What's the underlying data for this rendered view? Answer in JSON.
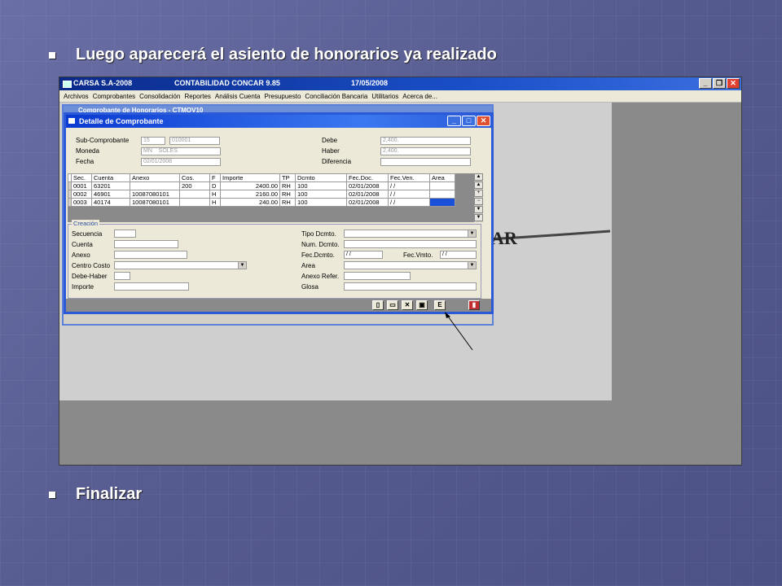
{
  "slide": {
    "bullet1": "Luego aparecerá el asiento de honorarios ya realizado",
    "bullet2": "Finalizar"
  },
  "app": {
    "title_company": "CARSA S.A-2008",
    "title_app": "CONTABILIDAD CONCAR 9.85",
    "title_date": "17/05/2008",
    "menu": [
      "Archivos",
      "Comprobantes",
      "Consolidación",
      "Reportes",
      "Análisis Cuenta",
      "Presupuesto",
      "Conciliación Bancaria",
      "Utilitarios",
      "Acerca de..."
    ],
    "logo_text": "AR"
  },
  "back_window": {
    "title": "Comprobante de Honorarios - CTMOV10"
  },
  "dialog": {
    "title": "Detalle de Comprobante",
    "header": {
      "sub_label": "Sub-Comprobante",
      "sub_value_1": "15",
      "sub_value_2": "010001",
      "moneda_label": "Moneda",
      "moneda_code": "MN",
      "moneda_name": "SOLES",
      "fecha_label": "Fecha",
      "fecha_value": "02/01/2008",
      "debe_label": "Debe",
      "debe_value": "2,400.",
      "haber_label": "Haber",
      "haber_value": "2,400.",
      "diferencia_label": "Diferencia",
      "diferencia_value": ""
    },
    "grid": {
      "columns": [
        "Sec.",
        "Cuenta",
        "Anexo",
        "Cos.",
        "F",
        "Importe",
        "TP",
        "Dcmto",
        "Fec.Doc.",
        "Fec.Ven.",
        "Area"
      ],
      "rows": [
        [
          "0001",
          "63201",
          "",
          "200",
          "D",
          "2400.00",
          "RH",
          "100",
          "02/01/2008",
          "/ /",
          ""
        ],
        [
          "0002",
          "46901",
          "10087080101",
          "",
          "H",
          "2160.00",
          "RH",
          "100",
          "02/01/2008",
          "/ /",
          ""
        ],
        [
          "0003",
          "40174",
          "10087080101",
          "",
          "H",
          "240.00",
          "RH",
          "100",
          "02/01/2008",
          "/ /",
          ""
        ]
      ]
    },
    "creacion": {
      "legend": "Creación",
      "left_labels": [
        "Secuencia",
        "Cuenta",
        "Anexo",
        "Centro Costo",
        "Debe-Haber",
        "Importe"
      ],
      "right_labels": [
        "Tipo Dcmto.",
        "Num. Dcmto.",
        "Fec.Dcmto.",
        "Area",
        "Anexo Refer.",
        "Glosa"
      ],
      "fec_dcmto_value": "/ /",
      "fec_vmto_label": "Fec.Vmto.",
      "fec_vmto_value": "/ /"
    },
    "toolbar": {
      "e_label": "E"
    }
  }
}
